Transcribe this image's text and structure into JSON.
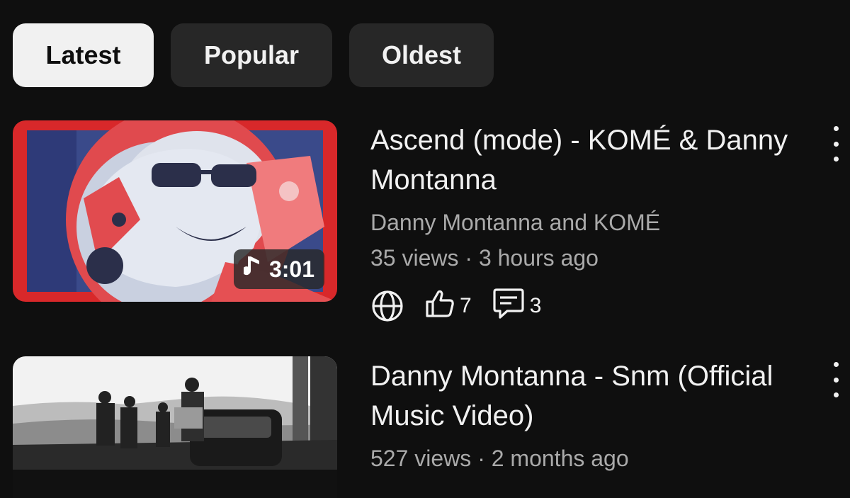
{
  "chips": [
    {
      "label": "Latest",
      "active": true
    },
    {
      "label": "Popular",
      "active": false
    },
    {
      "label": "Oldest",
      "active": false
    }
  ],
  "videos": [
    {
      "title": "Ascend (mode) - KOMÉ & Danny Montanna",
      "channel": "Danny Montanna and KOMÉ",
      "views": "35 views",
      "age": "3 hours ago",
      "duration": "3:01",
      "duration_icon": "music-note-icon",
      "likes": "7",
      "comments": "3",
      "visibility_icon": "globe-icon",
      "thumbnail_accent": "#d8282a"
    },
    {
      "title": "Danny Montanna - Snm (Official Music Video)",
      "views": "527 views",
      "age": "2 months ago"
    }
  ],
  "separator": "·"
}
